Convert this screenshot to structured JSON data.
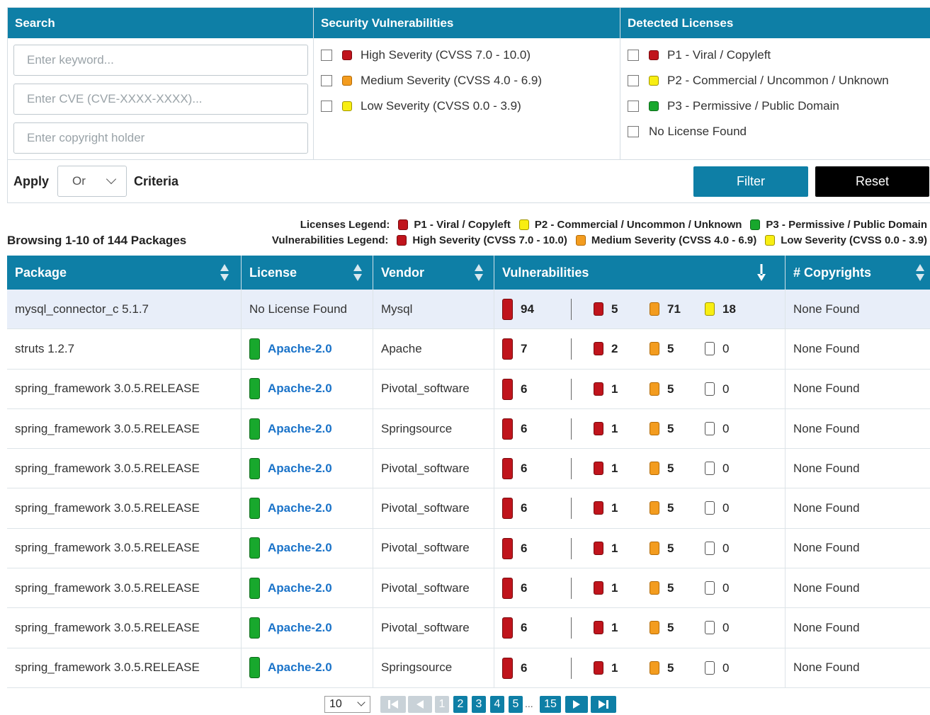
{
  "filters": {
    "search": {
      "title": "Search",
      "keyword_placeholder": "Enter keyword...",
      "cve_placeholder": "Enter CVE (CVE-XXXX-XXXX)...",
      "copyright_placeholder": "Enter copyright holder"
    },
    "vulnerabilities": {
      "title": "Security Vulnerabilities",
      "options": [
        {
          "label": "High Severity (CVSS 7.0 - 10.0)",
          "color": "#c0141c"
        },
        {
          "label": "Medium Severity (CVSS 4.0 - 6.9)",
          "color": "#f39c1f"
        },
        {
          "label": "Low Severity (CVSS 0.0 - 3.9)",
          "color": "#f8ee12"
        }
      ]
    },
    "licenses": {
      "title": "Detected Licenses",
      "options": [
        {
          "label": "P1 - Viral / Copyleft",
          "color": "#c0141c"
        },
        {
          "label": "P2 - Commercial / Uncommon / Unknown",
          "color": "#f8ee12"
        },
        {
          "label": "P3 - Permissive / Public Domain",
          "color": "#18a82d"
        },
        {
          "label": "No License Found",
          "color": ""
        }
      ]
    },
    "criteria": {
      "apply_label": "Apply",
      "operator": "Or",
      "criteria_label": "Criteria",
      "filter_button": "Filter",
      "reset_button": "Reset"
    }
  },
  "legend": {
    "browsing": "Browsing 1-10 of 144 Packages",
    "licenses_title": "Licenses Legend:",
    "licenses": [
      {
        "label": "P1 - Viral / Copyleft",
        "color": "#c0141c"
      },
      {
        "label": "P2 - Commercial / Uncommon / Unknown",
        "color": "#f8ee12"
      },
      {
        "label": "P3 - Permissive / Public Domain",
        "color": "#18a82d"
      }
    ],
    "vulns_title": "Vulnerabilities Legend:",
    "vulns": [
      {
        "label": "High Severity (CVSS 7.0 - 10.0)",
        "color": "#c0141c"
      },
      {
        "label": "Medium Severity (CVSS 4.0 - 6.9)",
        "color": "#f39c1f"
      },
      {
        "label": "Low Severity (CVSS 0.0 - 3.9)",
        "color": "#f8ee12"
      }
    ]
  },
  "table": {
    "columns": [
      "Package",
      "License",
      "Vendor",
      "Vulnerabilities",
      "# Copyrights"
    ],
    "rows": [
      {
        "package": "mysql_connector_c 5.1.7",
        "license": "No License Found",
        "license_link": false,
        "vendor": "Mysql",
        "total": "94",
        "high": "5",
        "medium": "71",
        "low": "18",
        "copyrights": "None Found"
      },
      {
        "package": "struts 1.2.7",
        "license": "Apache-2.0",
        "license_link": true,
        "vendor": "Apache",
        "total": "7",
        "high": "2",
        "medium": "5",
        "low": "0",
        "copyrights": "None Found"
      },
      {
        "package": "spring_framework 3.0.5.RELEASE",
        "license": "Apache-2.0",
        "license_link": true,
        "vendor": "Pivotal_software",
        "total": "6",
        "high": "1",
        "medium": "5",
        "low": "0",
        "copyrights": "None Found"
      },
      {
        "package": "spring_framework 3.0.5.RELEASE",
        "license": "Apache-2.0",
        "license_link": true,
        "vendor": "Springsource",
        "total": "6",
        "high": "1",
        "medium": "5",
        "low": "0",
        "copyrights": "None Found"
      },
      {
        "package": "spring_framework 3.0.5.RELEASE",
        "license": "Apache-2.0",
        "license_link": true,
        "vendor": "Pivotal_software",
        "total": "6",
        "high": "1",
        "medium": "5",
        "low": "0",
        "copyrights": "None Found"
      },
      {
        "package": "spring_framework 3.0.5.RELEASE",
        "license": "Apache-2.0",
        "license_link": true,
        "vendor": "Pivotal_software",
        "total": "6",
        "high": "1",
        "medium": "5",
        "low": "0",
        "copyrights": "None Found"
      },
      {
        "package": "spring_framework 3.0.5.RELEASE",
        "license": "Apache-2.0",
        "license_link": true,
        "vendor": "Pivotal_software",
        "total": "6",
        "high": "1",
        "medium": "5",
        "low": "0",
        "copyrights": "None Found"
      },
      {
        "package": "spring_framework 3.0.5.RELEASE",
        "license": "Apache-2.0",
        "license_link": true,
        "vendor": "Pivotal_software",
        "total": "6",
        "high": "1",
        "medium": "5",
        "low": "0",
        "copyrights": "None Found"
      },
      {
        "package": "spring_framework 3.0.5.RELEASE",
        "license": "Apache-2.0",
        "license_link": true,
        "vendor": "Pivotal_software",
        "total": "6",
        "high": "1",
        "medium": "5",
        "low": "0",
        "copyrights": "None Found"
      },
      {
        "package": "spring_framework 3.0.5.RELEASE",
        "license": "Apache-2.0",
        "license_link": true,
        "vendor": "Springsource",
        "total": "6",
        "high": "1",
        "medium": "5",
        "low": "0",
        "copyrights": "None Found"
      }
    ]
  },
  "pagination": {
    "page_size": "10",
    "pages": [
      "1",
      "2",
      "3",
      "4",
      "5"
    ],
    "current": "1",
    "ellipsis": "...",
    "last_page": "15"
  }
}
